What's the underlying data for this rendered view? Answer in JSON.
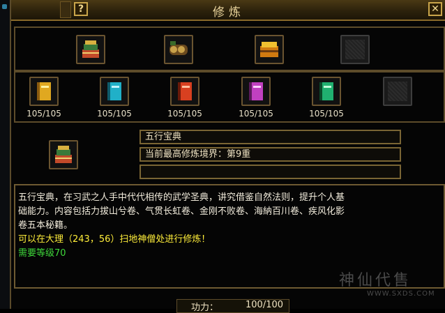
{
  "window": {
    "title": "修炼"
  },
  "top_icons": [
    {
      "icon": "book-stack-icon",
      "colors": [
        "#c24a2a",
        "#3a7a3a",
        "#d8b040"
      ]
    },
    {
      "icon": "scroll-bundle-icon",
      "colors": [
        "#6b4a1e",
        "#c9a24a",
        "#3a6a2a"
      ]
    },
    {
      "icon": "gold-chest-icon",
      "colors": [
        "#d07a10",
        "#f0c030",
        "#6a3a10"
      ]
    },
    {
      "icon": "empty-slot-icon"
    }
  ],
  "books": [
    {
      "icon": "yellow-book-icon",
      "color": "#e0a820",
      "count": "105/105"
    },
    {
      "icon": "cyan-book-icon",
      "color": "#20b0c8",
      "count": "105/105"
    },
    {
      "icon": "red-book-icon",
      "color": "#d84020",
      "count": "105/105"
    },
    {
      "icon": "purple-book-icon",
      "color": "#c040c0",
      "count": "105/105"
    },
    {
      "icon": "green-book-icon",
      "color": "#20b070",
      "count": "105/105"
    },
    {
      "icon": "empty-slot-icon"
    }
  ],
  "selected": {
    "name": "五行宝典",
    "realm": "当前最高修炼境界：第9重",
    "extra": ""
  },
  "description": {
    "line1": "五行宝典，在习武之人手中代代相传的武学圣典，讲究借鉴自然法则，提升个人基",
    "line2": "础能力。内容包括力拔山兮卷、气贯长虹卷、金刚不败卷、海納百川卷、疾风化影",
    "line3": "卷五本秘籍。",
    "hint": "可以在大理（243，56）扫地神僧处进行修炼！",
    "level": "需要等级70"
  },
  "footer": {
    "label": "功力：",
    "value": "100/100"
  },
  "watermark": {
    "text": "神仙代售",
    "url": "WWW.SXDS.COM"
  }
}
